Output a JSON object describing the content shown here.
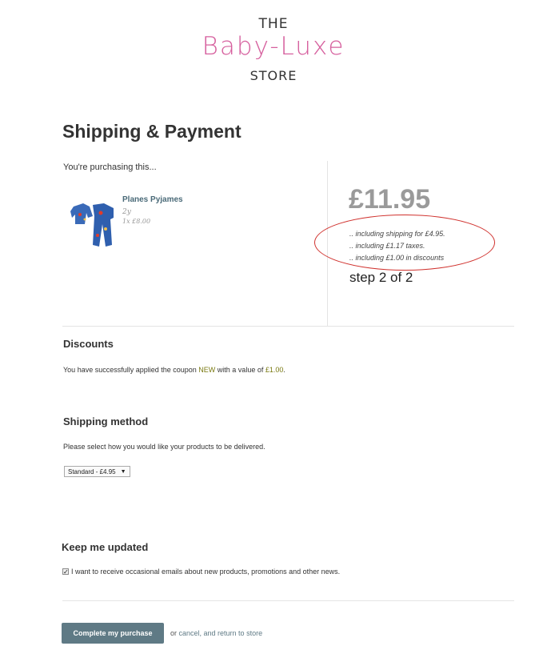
{
  "header": {
    "logo_the": "THE",
    "logo_name": "Baby-Luxe",
    "logo_store": "STORE",
    "brand_color": "#d6609e"
  },
  "page": {
    "title": "Shipping & Payment"
  },
  "order": {
    "purchasing_label": "You're purchasing this...",
    "product": {
      "name": "Planes Pyjames",
      "size": "2y",
      "qty_price": "1x £8.00",
      "image_icon": "pyjamas-image"
    },
    "total": "£11.95",
    "breakdown": [
      ".. including shipping for £4.95.",
      ".. including £1.17 taxes.",
      ".. including £1.00 in discounts"
    ],
    "step": "step 2 of 2",
    "annotation_color": "#d0312d"
  },
  "discounts": {
    "title": "Discounts",
    "text_prefix": "You have successfully applied the coupon ",
    "coupon": "NEW",
    "text_middle": " with a value of ",
    "value": "£1.00",
    "text_suffix": "."
  },
  "shipping": {
    "title": "Shipping method",
    "instruction": "Please select how you would like your products to be delivered.",
    "selected_option": "Standard - £4.95"
  },
  "updates": {
    "title": "Keep me updated",
    "checked": true,
    "checkbox_mark": "✓",
    "label": "I want to receive occasional emails about new products, promotions and other news."
  },
  "actions": {
    "submit_label": "Complete my purchase",
    "or_text": "or ",
    "cancel_label": "cancel, and return to store",
    "button_color": "#5f7a85"
  }
}
